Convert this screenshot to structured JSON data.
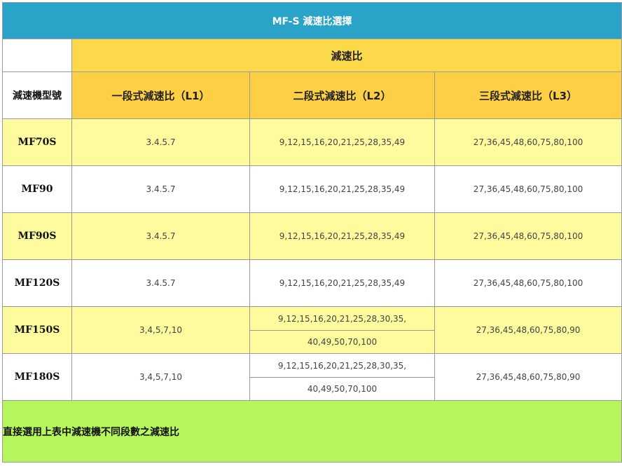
{
  "title": "MF-S 減速比選擇",
  "header": {
    "group_label": "減速比",
    "model_label": "減速機型號",
    "stage1": "一段式減速比（L1）",
    "stage2": "二段式減速比（L2）",
    "stage3": "三段式減速比（L3）"
  },
  "rows": [
    {
      "model": "MF70S",
      "l1": "3.4.5.7",
      "l2": "9,12,15,16,20,21,25,28,35,49",
      "l3": "27,36,45,48,60,75,80,100"
    },
    {
      "model": "MF90",
      "l1": "3.4.5.7",
      "l2": "9,12,15,16,20,21,25,28,35,49",
      "l3": "27,36,45,48,60,75,80,100"
    },
    {
      "model": "MF90S",
      "l1": "3.4.5.7",
      "l2": "9,12,15,16,20,21,25,28,35,49",
      "l3": "27,36,45,48,60,75,80,100"
    },
    {
      "model": "MF120S",
      "l1": "3.4.5.7",
      "l2": "9,12,15,16,20,21,25,28,35,49",
      "l3": "27,36,45,48,60,75,80,100"
    },
    {
      "model": "MF150S",
      "l1": "3,4,5,7,10",
      "l2a": "9,12,15,16,20,21,25,28,30,35,",
      "l2b": "40,49,50,70,100",
      "l3": "27,36,45,48,60,75,80,90"
    },
    {
      "model": "MF180S",
      "l1": "3,4,5,7,10",
      "l2a": "9,12,15,16,20,21,25,28,30,35,",
      "l2b": "40,49,50,70,100",
      "l3": "27,36,45,48,60,75,80,90"
    }
  ],
  "footer": "直接選用上表中減速機不同段數之減速比",
  "colors": {
    "title_bg": "#2aa3c9",
    "header_bg": "#fcd94a",
    "row_yellow": "#fdfb9d",
    "row_white": "#ffffff",
    "footer_bg": "#b6f55b"
  }
}
